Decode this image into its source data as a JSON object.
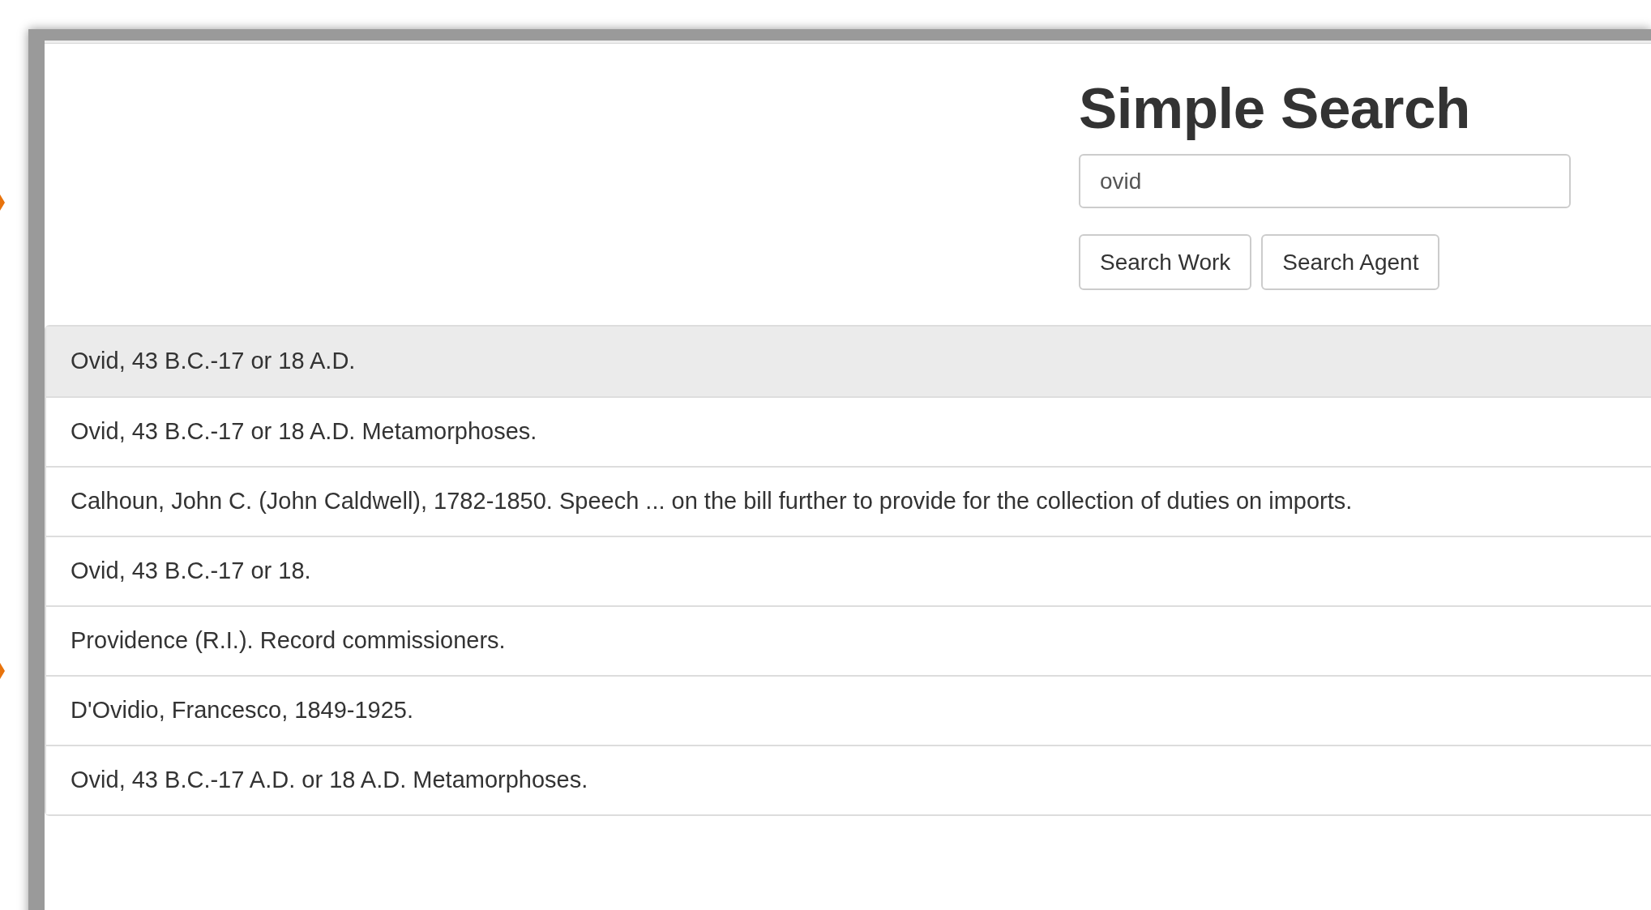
{
  "title": "Simple Search",
  "search": {
    "value": "ovid"
  },
  "buttons": [
    "Search Work",
    "Search Agent"
  ],
  "results": [
    {
      "text": "Ovid, 43 B.C.-17 or 18 A.D.",
      "selected": true
    },
    {
      "text": "Ovid, 43 B.C.-17 or 18 A.D. Metamorphoses.",
      "selected": false
    },
    {
      "text": "Calhoun, John C. (John Caldwell), 1782-1850. Speech ... on the bill further to provide for the collection of duties on imports.",
      "selected": false
    },
    {
      "text": "Ovid, 43 B.C.-17 or 18.",
      "selected": false
    },
    {
      "text": "Providence (R.I.). Record commissioners.",
      "selected": false
    },
    {
      "text": "D'Ovidio, Francesco, 1849-1925.",
      "selected": false
    },
    {
      "text": "Ovid, 43 B.C.-17 A.D. or 18 A.D. Metamorphoses.",
      "selected": false
    }
  ]
}
